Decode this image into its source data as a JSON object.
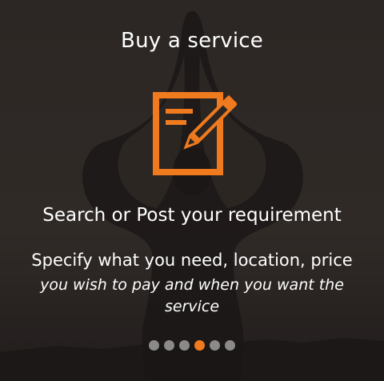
{
  "slide": {
    "title": "Buy a service",
    "icon": "edit-document-icon",
    "headline": "Search or Post your requirement",
    "description_line1": "Specify what you need, location, price",
    "description_line2": "you wish to pay and when you want the service"
  },
  "pager": {
    "count": 6,
    "active_index": 3
  },
  "colors": {
    "accent": "#f07a1e",
    "dot_inactive": "#8a8a8a",
    "text": "#ffffff",
    "background": "#2b2624"
  }
}
